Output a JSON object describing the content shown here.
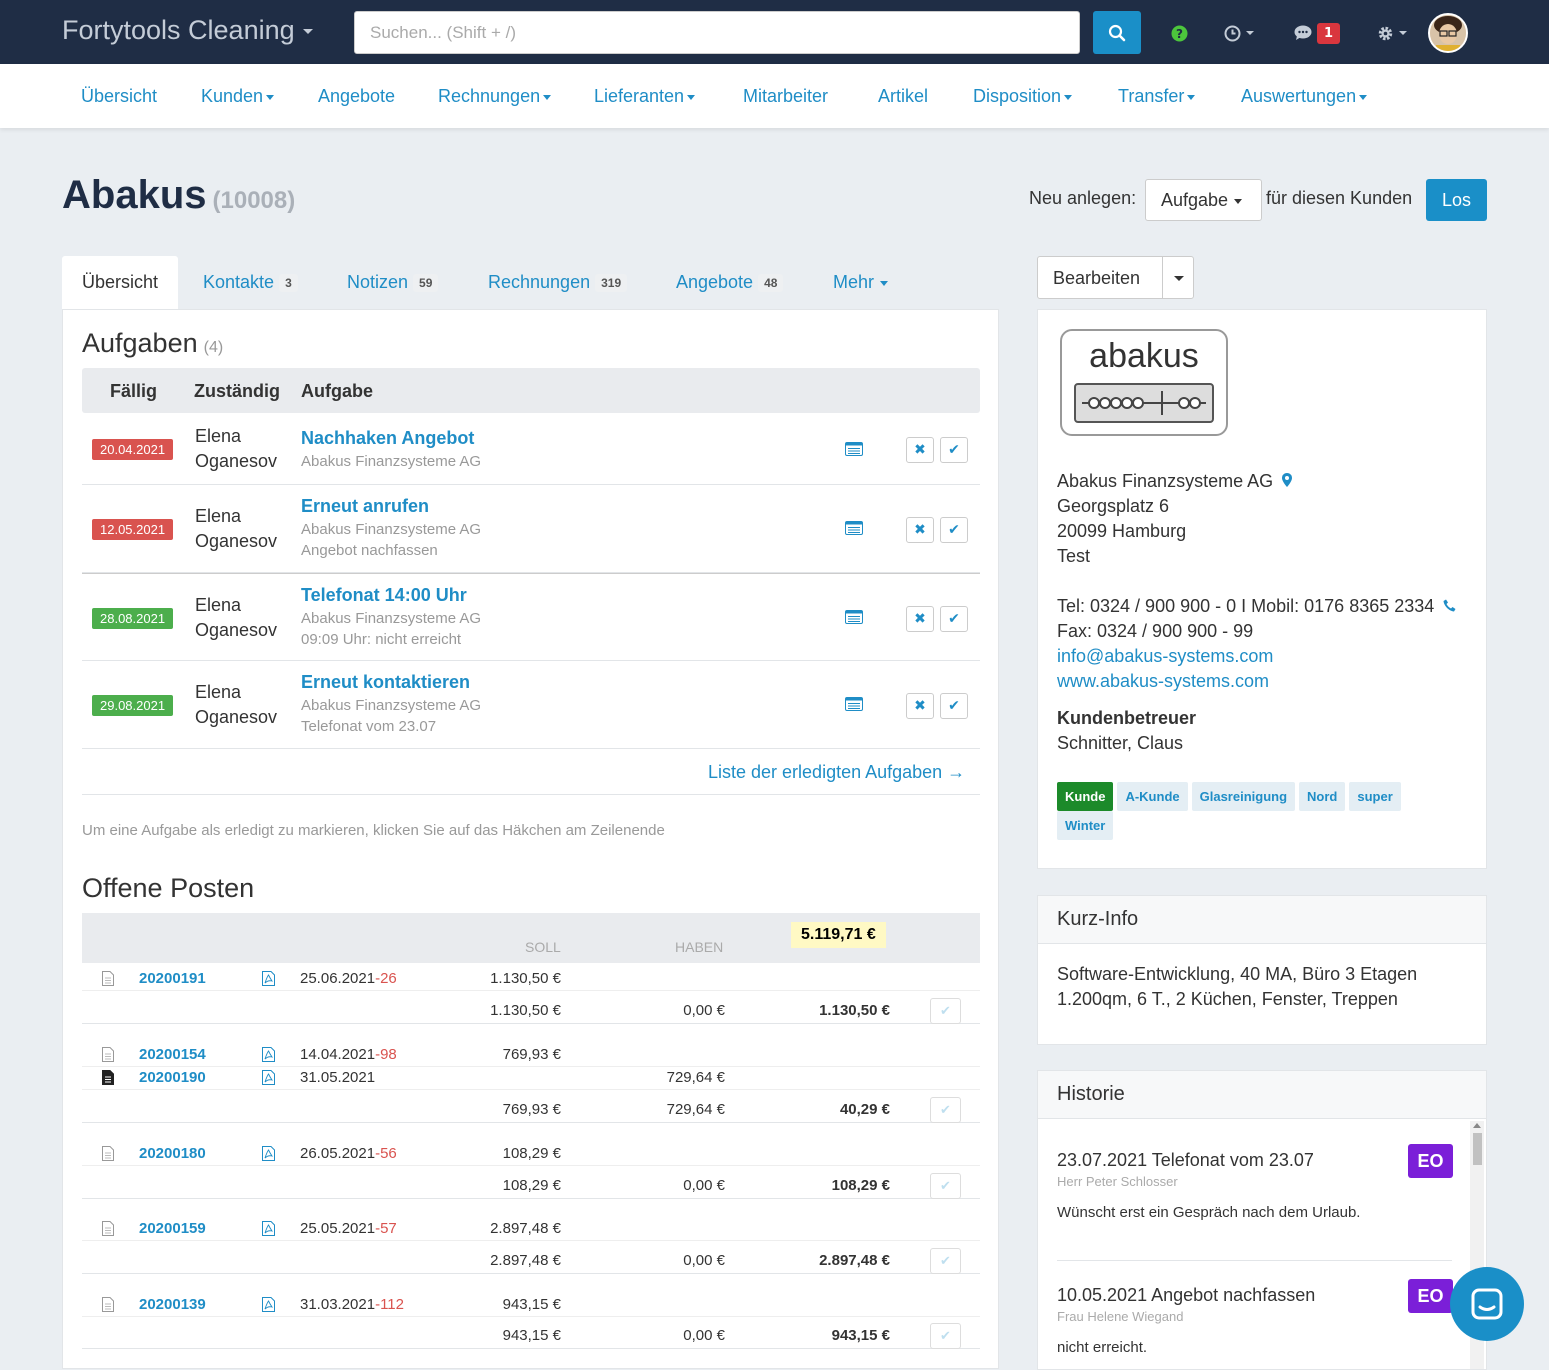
{
  "topbar": {
    "brand": "Fortytools Cleaning",
    "search_placeholder": "Suchen... (Shift + /)",
    "messages_count": "1"
  },
  "nav": {
    "items": [
      "Übersicht",
      "Kunden",
      "Angebote",
      "Rechnungen",
      "Lieferanten",
      "Mitarbeiter",
      "Artikel",
      "Disposition",
      "Transfer",
      "Auswertungen"
    ]
  },
  "header": {
    "title": "Abakus",
    "customer_id": "(10008)",
    "neu_label": "Neu anlegen:",
    "neu_select": "Aufgabe",
    "fuer_label": "für diesen Kunden",
    "los_button": "Los"
  },
  "tabs": [
    {
      "label": "Übersicht"
    },
    {
      "label": "Kontakte",
      "count": "3"
    },
    {
      "label": "Notizen",
      "count": "59"
    },
    {
      "label": "Rechnungen",
      "count": "319"
    },
    {
      "label": "Angebote",
      "count": "48"
    },
    {
      "label": "Mehr"
    }
  ],
  "aufgaben": {
    "title": "Aufgaben",
    "count": "(4)",
    "headers": {
      "faellig": "Fällig",
      "zustaendig": "Zuständig",
      "aufgabe": "Aufgabe"
    },
    "rows": [
      {
        "date": "20.04.2021",
        "status": "overdue",
        "person": "Elena Oganesov",
        "title": "Nachhaken Angebot",
        "company": "Abakus Finanzsysteme AG",
        "note": ""
      },
      {
        "date": "12.05.2021",
        "status": "overdue",
        "person": "Elena Oganesov",
        "title": "Erneut anrufen",
        "company": "Abakus Finanzsysteme AG",
        "note": "Angebot nachfassen"
      },
      {
        "date": "28.08.2021",
        "status": "upcoming",
        "person": "Elena Oganesov",
        "title": "Telefonat 14:00 Uhr",
        "company": "Abakus Finanzsysteme AG",
        "note": "09:09 Uhr: nicht erreicht"
      },
      {
        "date": "29.08.2021",
        "status": "upcoming",
        "person": "Elena Oganesov",
        "title": "Erneut kontaktieren",
        "company": "Abakus Finanzsysteme AG",
        "note": "Telefonat vom 23.07"
      }
    ],
    "list_link": "Liste der erledigten Aufgaben →",
    "hint": "Um eine Aufgabe als erledigt zu markieren, klicken Sie auf das Häkchen am Zeilenende"
  },
  "offene_posten": {
    "title": "Offene Posten",
    "soll_label": "SOLL",
    "haben_label": "HABEN",
    "total": "5.119,71 €",
    "groups": [
      {
        "lines": [
          {
            "number": "20200191",
            "date": "25.06.2021",
            "days": "-26",
            "soll": "1.130,50 €",
            "haben": "",
            "doc_type": "outline"
          }
        ],
        "sum": {
          "soll": "1.130,50 €",
          "haben": "0,00 €",
          "balance": "1.130,50 €"
        }
      },
      {
        "lines": [
          {
            "number": "20200154",
            "date": "14.04.2021",
            "days": "-98",
            "soll": "769,93 €",
            "haben": "",
            "doc_type": "outline"
          },
          {
            "number": "20200190",
            "date": "31.05.2021",
            "days": "",
            "soll": "",
            "haben": "729,64 €",
            "doc_type": "filled"
          }
        ],
        "sum": {
          "soll": "769,93 €",
          "haben": "729,64 €",
          "balance": "40,29 €"
        }
      },
      {
        "lines": [
          {
            "number": "20200180",
            "date": "26.05.2021",
            "days": "-56",
            "soll": "108,29 €",
            "haben": "",
            "doc_type": "outline"
          }
        ],
        "sum": {
          "soll": "108,29 €",
          "haben": "0,00 €",
          "balance": "108,29 €"
        }
      },
      {
        "lines": [
          {
            "number": "20200159",
            "date": "25.05.2021",
            "days": "-57",
            "soll": "2.897,48 €",
            "haben": "",
            "doc_type": "outline"
          }
        ],
        "sum": {
          "soll": "2.897,48 €",
          "haben": "0,00 €",
          "balance": "2.897,48 €"
        }
      },
      {
        "lines": [
          {
            "number": "20200139",
            "date": "31.03.2021",
            "days": "-112",
            "soll": "943,15 €",
            "haben": "",
            "doc_type": "outline"
          }
        ],
        "sum": {
          "soll": "943,15 €",
          "haben": "0,00 €",
          "balance": "943,15 €"
        }
      }
    ]
  },
  "sidebar": {
    "bearbeiten": "Bearbeiten",
    "logo_text": "abakus",
    "company": "Abakus Finanzsysteme AG",
    "street": "Georgsplatz 6",
    "city": "20099 Hamburg",
    "extra": "Test",
    "tel": "Tel: 0324 / 900 900 - 0 I Mobil: 0176 8365 2334",
    "fax": "Fax: 0324 / 900 900 - 99",
    "email": "info@abakus-systems.com",
    "web": "www.abakus-systems.com",
    "betreuer_label": "Kundenbetreuer",
    "betreuer": "Schnitter, Claus",
    "tags": [
      "Kunde",
      "A-Kunde",
      "Glasreinigung",
      "Nord",
      "super",
      "Winter"
    ]
  },
  "kurzinfo": {
    "title": "Kurz-Info",
    "line1": "Software-Entwicklung, 40 MA, Büro 3 Etagen",
    "line2": "1.200qm, 6 T., 2 Küchen, Fenster, Treppen"
  },
  "historie": {
    "title": "Historie",
    "entries": [
      {
        "title": "23.07.2021 Telefonat vom 23.07",
        "contact": "Herr Peter Schlosser",
        "body": "Wünscht erst ein Gespräch nach dem Urlaub.",
        "initials": "EO"
      },
      {
        "title": "10.05.2021 Angebot nachfassen",
        "contact": "Frau Helene Wiegand",
        "body": "nicht erreicht.",
        "initials": "EO"
      }
    ]
  },
  "colors": {
    "topbar": "#1f2d45",
    "accent": "#1a8fc8",
    "overdue": "#d9534f",
    "upcoming": "#4cae4c",
    "initials_badge": "#7b1fd8"
  }
}
